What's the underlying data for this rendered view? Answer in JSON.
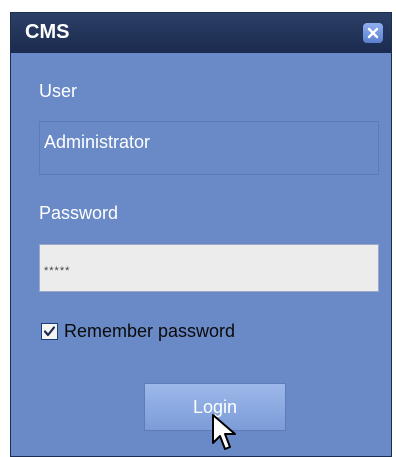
{
  "window": {
    "title": "CMS",
    "close_icon": "close-icon"
  },
  "user": {
    "label": "User",
    "value": "Administrator"
  },
  "password": {
    "label": "Password",
    "value": "*****"
  },
  "remember": {
    "label": "Remember password",
    "checked": true
  },
  "login": {
    "label": "Login"
  },
  "colors": {
    "titlebar": "#1b2b4f",
    "window_bg": "#6a8ac7",
    "button_bg": "#8aa8e0"
  }
}
